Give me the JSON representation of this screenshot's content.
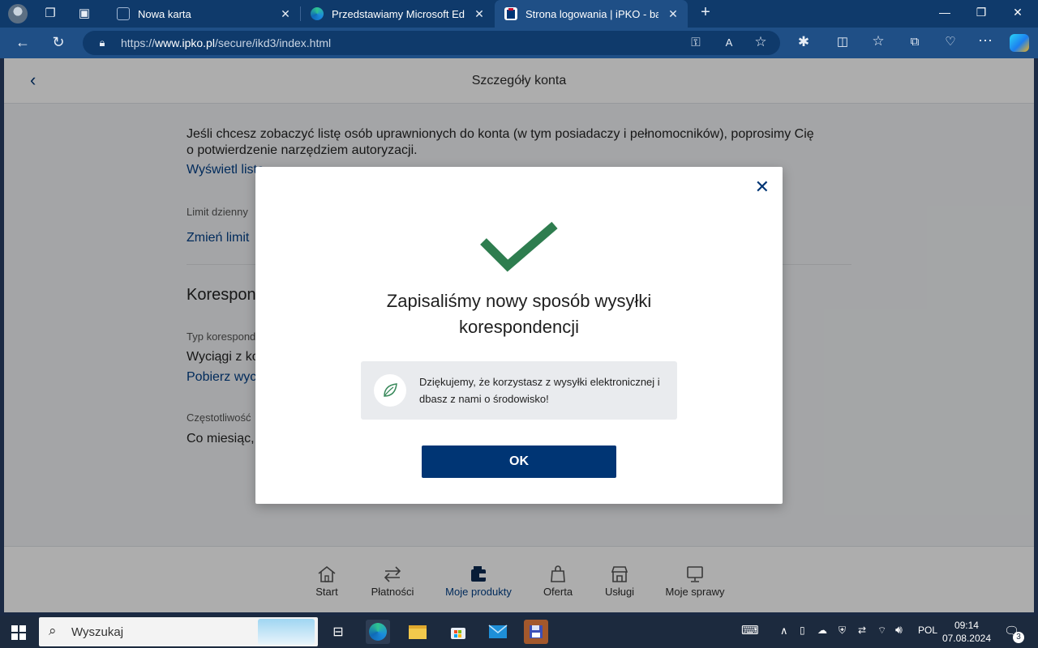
{
  "browser": {
    "tabs": [
      {
        "title": "Nowa karta",
        "active": false
      },
      {
        "title": "Przedstawiamy Microsoft Edge",
        "active": false
      },
      {
        "title": "Strona logowania | iPKO - bankowość",
        "active": true
      }
    ],
    "new_tab": "+",
    "url_prefix": "https://",
    "url_domain": "www.ipko.pl",
    "url_path": "/secure/ikd3/index.html"
  },
  "page": {
    "title": "Szczegóły konta",
    "auth_text": "Jeśli chcesz zobaczyć listę osób uprawnionych do konta (w tym posiadaczy i pełnomocników), poprosimy Cię o potwierdzenie narzędziem autoryzacji.",
    "show_list_link": "Wyświetl listę",
    "daily_limit_label": "Limit dzienny",
    "change_limit_link": "Zmień limit",
    "correspondence_heading": "Korespondencja",
    "correspondence_type_label": "Typ korespondencji",
    "correspondence_type_value": "Wyciągi z konta",
    "download_link": "Pobierz wyciąg",
    "frequency_label": "Częstotliwość",
    "frequency_value": "Co miesiąc,"
  },
  "modal": {
    "title_line1": "Zapisaliśmy nowy sposób wysyłki",
    "title_line2": "korespondencji",
    "info": "Dziękujemy, że korzystasz z wysyłki elektronicznej i dbasz z nami o środowisko!",
    "ok_label": "OK"
  },
  "bottom_nav": [
    {
      "label": "Start",
      "icon": "home-icon"
    },
    {
      "label": "Płatności",
      "icon": "transfer-icon"
    },
    {
      "label": "Moje produkty",
      "icon": "wallet-icon",
      "active": true
    },
    {
      "label": "Oferta",
      "icon": "bag-icon"
    },
    {
      "label": "Usługi",
      "icon": "store-icon"
    },
    {
      "label": "Moje sprawy",
      "icon": "monitor-icon"
    }
  ],
  "taskbar": {
    "search_placeholder": "Wyszukaj",
    "language": "POL",
    "time": "09:14",
    "date": "07.08.2024",
    "notifications": "3"
  },
  "colors": {
    "brand_navy": "#003574",
    "link_blue": "#003f87",
    "check_green": "#2e7d4f",
    "edge_tab": "#1f4f86"
  }
}
